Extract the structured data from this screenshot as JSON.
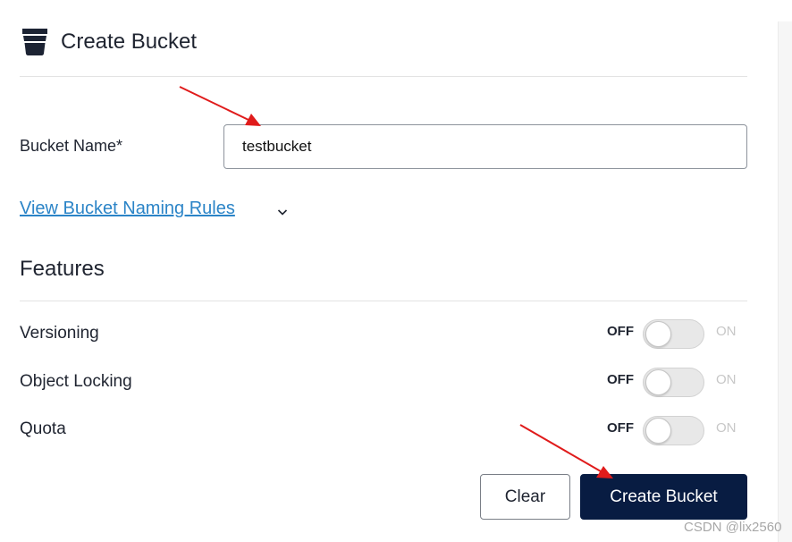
{
  "header": {
    "title": "Create Bucket",
    "icon": "bucket-icon"
  },
  "form": {
    "bucket_name_label": "Bucket Name*",
    "bucket_name_value": "testbucket",
    "naming_rules_link": "View Bucket Naming Rules"
  },
  "features": {
    "title": "Features",
    "items": [
      {
        "label": "Versioning",
        "off": "OFF",
        "on": "ON",
        "enabled": false
      },
      {
        "label": "Object Locking",
        "off": "OFF",
        "on": "ON",
        "enabled": false
      },
      {
        "label": "Quota",
        "off": "OFF",
        "on": "ON",
        "enabled": false
      }
    ]
  },
  "actions": {
    "clear_label": "Clear",
    "create_label": "Create Bucket"
  },
  "watermark": "CSDN @lix2560",
  "colors": {
    "primary": "#081c42",
    "link": "#2b84c7",
    "annotation_arrow": "#e01b1b"
  }
}
